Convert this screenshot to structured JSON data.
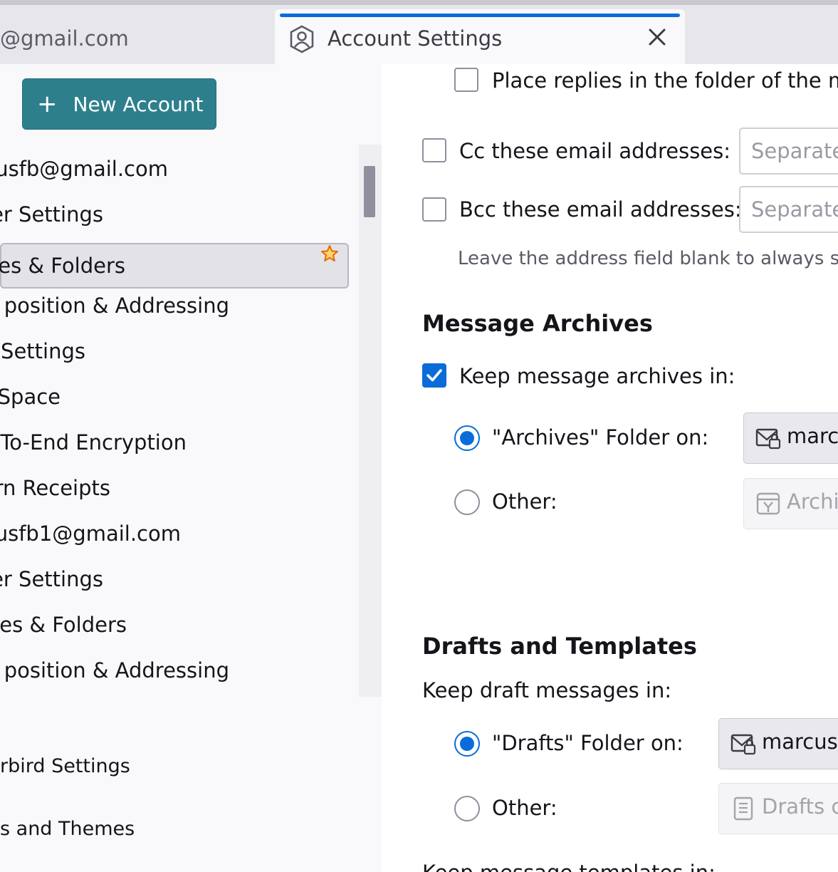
{
  "tabs": {
    "inactive_title": "@gmail.com",
    "active_title": "Account Settings"
  },
  "sidebar": {
    "new_account_label": "New Account",
    "items": [
      {
        "label": "usfb@gmail.com"
      },
      {
        "label": "er Settings"
      },
      {
        "label": "es & Folders"
      },
      {
        "label": "position & Addressing"
      },
      {
        "label": " Settings"
      },
      {
        "label": " Space"
      },
      {
        "label": "To-End Encryption"
      },
      {
        "label": "rn Receipts"
      },
      {
        "label": "usfb1@gmail.com"
      },
      {
        "label": "er Settings"
      },
      {
        "label": "es & Folders"
      },
      {
        "label": "position & Addressing"
      }
    ],
    "footer_items": [
      "rbird Settings",
      "s and Themes"
    ]
  },
  "main": {
    "place_replies_label": "Place replies in the folder of the m",
    "cc_label": "Cc these email addresses:",
    "cc_placeholder": "Separate",
    "bcc_label": "Bcc these email addresses:",
    "bcc_placeholder": "Separate",
    "blank_hint": "Leave the address field blank to always sh",
    "archives_heading": "Message Archives",
    "keep_archives_label": "Keep message archives in:",
    "archives_folder_label": "\"Archives\" Folder on:",
    "archives_folder_value": "marc",
    "archives_other_label": "Other:",
    "archives_other_value": "Archi",
    "drafts_heading": "Drafts and Templates",
    "keep_drafts_label": "Keep draft messages in:",
    "drafts_folder_label": "\"Drafts\" Folder on:",
    "drafts_folder_value": "marcus",
    "drafts_other_label": "Other:",
    "drafts_other_value": "Drafts c",
    "templates_label": "Keep message templates in:"
  },
  "colors": {
    "accent": "#0a6cd9",
    "new_account_button": "#2e7f8c",
    "star": "#e66b00"
  }
}
